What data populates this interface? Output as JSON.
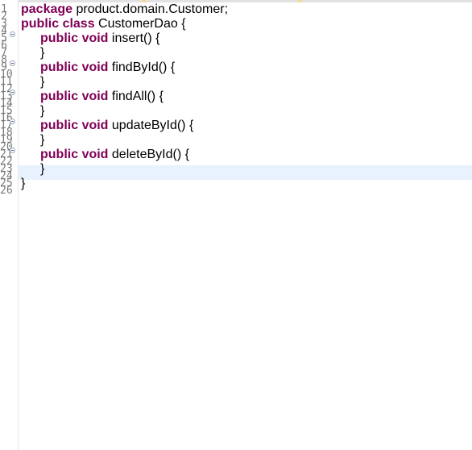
{
  "editor": {
    "colors": {
      "keyword": "#7f0055",
      "text": "#000000",
      "line_number": "#787878",
      "current_line": "#e8f2fe"
    },
    "current_line": 12,
    "lines": [
      {
        "n": "1",
        "fold": false,
        "tokens": [
          {
            "t": "package",
            "kw": true
          },
          {
            "t": " product.domain.Customer;"
          }
        ]
      },
      {
        "n": "2",
        "fold": false,
        "tokens": []
      },
      {
        "n": "3",
        "fold": false,
        "tokens": [
          {
            "t": "public",
            "kw": true
          },
          {
            "t": " "
          },
          {
            "t": "class",
            "kw": true
          },
          {
            "t": " CustomerDao {"
          }
        ]
      },
      {
        "n": "4",
        "fold": false,
        "tokens": []
      },
      {
        "n": "5",
        "fold": true,
        "indent": 1,
        "tokens": [
          {
            "t": "public",
            "kw": true
          },
          {
            "t": " "
          },
          {
            "t": "void",
            "kw": true
          },
          {
            "t": " insert() {"
          }
        ]
      },
      {
        "n": "6",
        "fold": false,
        "tokens": []
      },
      {
        "n": "7",
        "fold": false,
        "indent": 1,
        "tokens": [
          {
            "t": "}"
          }
        ]
      },
      {
        "n": "8",
        "fold": false,
        "tokens": []
      },
      {
        "n": "9",
        "fold": true,
        "indent": 1,
        "tokens": [
          {
            "t": "public",
            "kw": true
          },
          {
            "t": " "
          },
          {
            "t": "void",
            "kw": true
          },
          {
            "t": " findById() {"
          }
        ]
      },
      {
        "n": "10",
        "fold": false,
        "tokens": []
      },
      {
        "n": "11",
        "fold": false,
        "indent": 1,
        "tokens": [
          {
            "t": "}"
          }
        ]
      },
      {
        "n": "12",
        "fold": false,
        "tokens": []
      },
      {
        "n": "13",
        "fold": true,
        "indent": 1,
        "tokens": [
          {
            "t": "public",
            "kw": true
          },
          {
            "t": " "
          },
          {
            "t": "void",
            "kw": true
          },
          {
            "t": " findAll() {"
          }
        ]
      },
      {
        "n": "14",
        "fold": false,
        "tokens": []
      },
      {
        "n": "15",
        "fold": false,
        "indent": 1,
        "tokens": [
          {
            "t": "}"
          }
        ]
      },
      {
        "n": "16",
        "fold": false,
        "tokens": []
      },
      {
        "n": "17",
        "fold": true,
        "indent": 1,
        "tokens": [
          {
            "t": "public",
            "kw": true
          },
          {
            "t": " "
          },
          {
            "t": "void",
            "kw": true
          },
          {
            "t": " updateById() {"
          }
        ]
      },
      {
        "n": "18",
        "fold": false,
        "tokens": []
      },
      {
        "n": "19",
        "fold": false,
        "indent": 1,
        "tokens": [
          {
            "t": "}"
          }
        ]
      },
      {
        "n": "20",
        "fold": false,
        "tokens": []
      },
      {
        "n": "21",
        "fold": true,
        "indent": 1,
        "tokens": [
          {
            "t": "public",
            "kw": true
          },
          {
            "t": " "
          },
          {
            "t": "void",
            "kw": true
          },
          {
            "t": " deleteById() {"
          }
        ]
      },
      {
        "n": "22",
        "fold": false,
        "tokens": []
      },
      {
        "n": "23",
        "fold": false,
        "indent": 1,
        "tokens": [
          {
            "t": "}"
          }
        ]
      },
      {
        "n": "24",
        "fold": false,
        "tokens": []
      },
      {
        "n": "25",
        "fold": false,
        "tokens": [
          {
            "t": "}"
          }
        ]
      },
      {
        "n": "26",
        "fold": false,
        "tokens": []
      }
    ]
  }
}
